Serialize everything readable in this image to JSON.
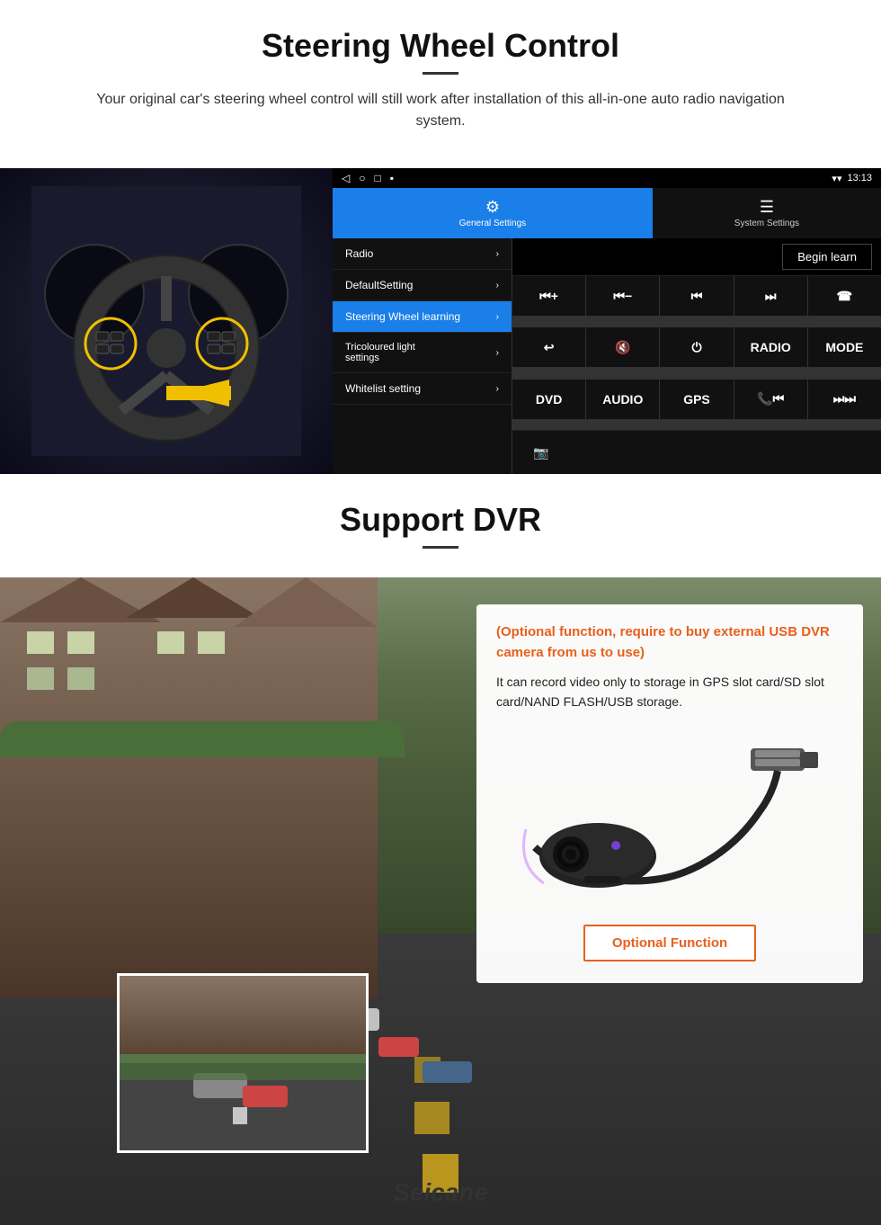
{
  "page": {
    "steering_section": {
      "title": "Steering Wheel Control",
      "subtitle": "Your original car's steering wheel control will still work after installation of this all-in-one auto radio navigation system.",
      "statusbar": {
        "back_icon": "◁",
        "home_icon": "○",
        "square_icon": "□",
        "menu_icon": "▪",
        "time": "13:13",
        "signal_icon": "▼",
        "wifi_icon": "▾"
      },
      "tabs": [
        {
          "label": "General Settings",
          "icon": "⚙",
          "active": true
        },
        {
          "label": "System Settings",
          "icon": "☰",
          "active": false
        }
      ],
      "menu_items": [
        {
          "label": "Radio",
          "arrow": "›",
          "active": false
        },
        {
          "label": "DefaultSetting",
          "arrow": "›",
          "active": false
        },
        {
          "label": "Steering Wheel learning",
          "arrow": "›",
          "active": true
        },
        {
          "label": "Tricoloured light settings",
          "arrow": "›",
          "active": false
        },
        {
          "label": "Whitelist setting",
          "arrow": "›",
          "active": false
        }
      ],
      "begin_learn": "Begin learn",
      "control_buttons": [
        "⏮+",
        "⏮−",
        "⏮⏮",
        "⏭⏭",
        "☎",
        "↩",
        "🔇",
        "⏻",
        "RADIO",
        "MODE",
        "DVD",
        "AUDIO",
        "GPS",
        "📞⏮",
        "⏭⏭"
      ]
    },
    "dvr_section": {
      "title": "Support DVR",
      "optional_text": "(Optional function, require to buy external USB DVR camera from us to use)",
      "description": "It can record video only to storage in GPS slot card/SD slot card/NAND FLASH/USB storage.",
      "optional_function_btn": "Optional Function",
      "seicane_label": "Seicane"
    }
  }
}
